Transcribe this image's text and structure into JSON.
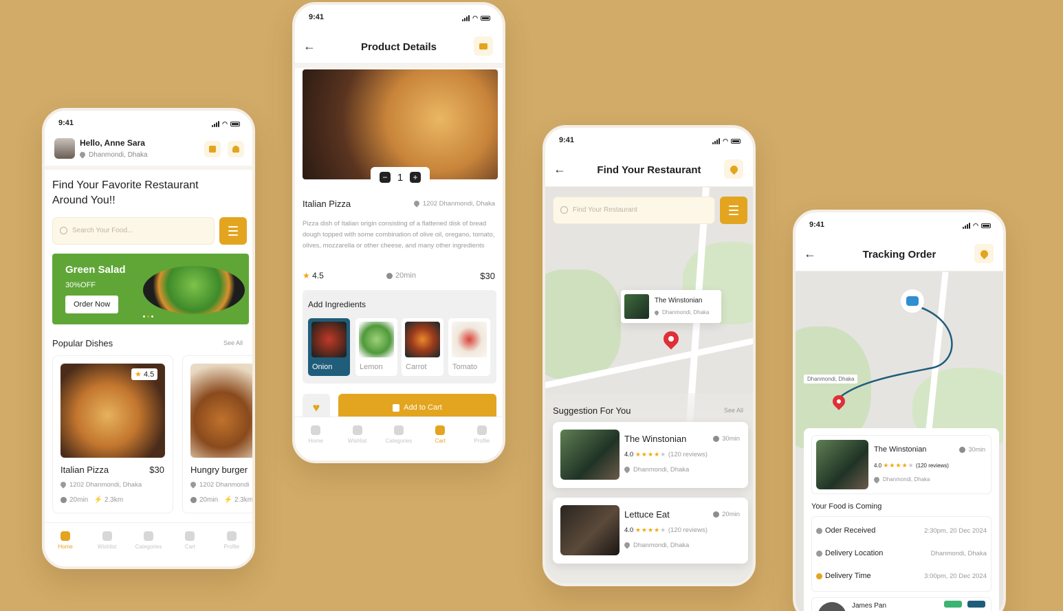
{
  "colors": {
    "accent": "#e3a51f",
    "green": "#5fa637",
    "teal": "#1f5d7a",
    "background": "#d2ab68"
  },
  "status": {
    "time": "9:41"
  },
  "home": {
    "greeting": "Hello, Anne Sara",
    "location": "Dhanmondi, Dhaka",
    "headline": "Find Your Favorite Restaurant Around You!!",
    "search_placeholder": "Search Your Food...",
    "banner": {
      "title": "Green Salad",
      "discount": "30%OFF",
      "button": "Order Now"
    },
    "section_title": "Popular Dishes",
    "see_all": "See All",
    "dishes": [
      {
        "name": "Italian Pizza",
        "price": "$30",
        "rating": "4.5",
        "address": "1202 Dhanmondi, Dhaka",
        "time": "20min",
        "distance": "2.3km"
      },
      {
        "name": "Hungry burger",
        "price": "",
        "rating": "",
        "address": "1202 Dhanmondi",
        "time": "20min",
        "distance": "2.3km"
      }
    ],
    "tabs": [
      "Home",
      "Wishlist",
      "Categories",
      "Cart",
      "Profile"
    ],
    "active_tab": "Home"
  },
  "product": {
    "title": "Product Details",
    "quantity": "1",
    "name": "Italian Pizza",
    "address": "1202 Dhanmondi, Dhaka",
    "description": "Pizza dish of Italian origin consisting of a flattened disk of bread dough topped with some combination of olive oil, oregano, tomato, olives, mozzarella or other cheese, and many other ingredients",
    "rating": "4.5",
    "time": "20min",
    "price": "$30",
    "ingredients_title": "Add Ingredients",
    "ingredients": [
      "Onion",
      "Lemon",
      "Carrot",
      "Tomato"
    ],
    "selected_ingredient": "Onion",
    "add_to_cart": "Add to Cart",
    "tabs": [
      "Home",
      "Wishlist",
      "Categories",
      "Cart",
      "Profile"
    ],
    "active_tab": "Cart"
  },
  "find": {
    "title": "Find Your Restaurant",
    "search_placeholder": "Find Your Restaurant",
    "map_label": {
      "name": "The Winstonian",
      "location": "Dhanmondi, Dhaka"
    },
    "suggest_title": "Suggestion For You",
    "see_all": "See All",
    "restaurants": [
      {
        "name": "The Winstonian",
        "time": "30min",
        "rating": "4.0",
        "stars_filled": 4,
        "reviews": "(120 reviews)",
        "location": "Dhanmondi, Dhaka"
      },
      {
        "name": "Lettuce Eat",
        "time": "20min",
        "rating": "4.0",
        "stars_filled": 4,
        "reviews": "(120 reviews)",
        "location": "Dhanmondi, Dhaka"
      }
    ]
  },
  "tracking": {
    "title": "Tracking Order",
    "map_label": "Dhanmondi, Dhaka",
    "restaurant": {
      "name": "The Winstonian",
      "time": "30min",
      "rating": "4.0",
      "stars_filled": 4,
      "reviews": "(120 reviews)",
      "location": "Dhanmondi, Dhaka"
    },
    "coming_title": "Your Food is Coming",
    "steps": [
      {
        "label": "Oder Received",
        "value": "2:30pm, 20 Dec 2024"
      },
      {
        "label": "Delivery Location",
        "value": "Dhanmondi, Dhaka"
      },
      {
        "label": "Delivery Time",
        "value": "3:00pm, 20 Dec 2024"
      }
    ],
    "driver": "James Pan"
  }
}
